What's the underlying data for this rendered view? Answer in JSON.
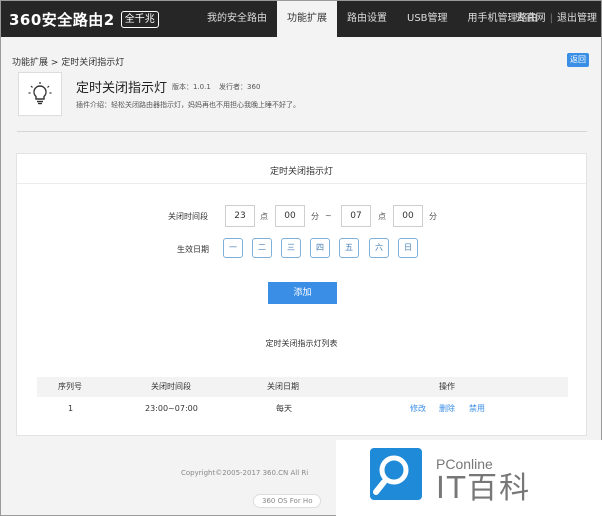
{
  "brand": {
    "name": "360安全路由2",
    "badge": "全千兆"
  },
  "nav": {
    "items": [
      "我的安全路由",
      "功能扩展",
      "路由设置",
      "USB管理",
      "用手机管理路由"
    ],
    "active_index": 1,
    "right": [
      "去官网",
      "退出管理"
    ]
  },
  "breadcrumb": "功能扩展 > 定时关闭指示灯",
  "back_label": "返回",
  "plugin": {
    "icon": "lightbulb-icon",
    "title": "定时关闭指示灯",
    "version": "版本：1.0.1",
    "publisher": "发行者：360",
    "description": "插件介绍：轻松关闭路由器指示灯，妈妈再也不用担心我晚上睡不好了。"
  },
  "form": {
    "title": "定时关闭指示灯",
    "time_label": "关闭时间段",
    "start_hour": "23",
    "start_min": "00",
    "end_hour": "07",
    "end_min": "00",
    "unit_hour": "点",
    "unit_min": "分",
    "range_sep": "~",
    "days_label": "生效日期",
    "days": [
      "一",
      "二",
      "三",
      "四",
      "五",
      "六",
      "日"
    ],
    "add_label": "添加"
  },
  "list": {
    "title": "定时关闭指示灯列表",
    "headers": [
      "序列号",
      "关闭时间段",
      "关闭日期",
      "操作"
    ],
    "rows": [
      {
        "index": "1",
        "time": "23:00~07:00",
        "date": "每天",
        "edit": "修改",
        "delete": "删除",
        "disable": "禁用"
      }
    ]
  },
  "footer": {
    "copyright": "Copyright©2005-2017 360.CN All Ri",
    "os": "360 OS For Ho"
  },
  "watermark": {
    "small": "PConline",
    "big": "IT百科"
  },
  "colors": {
    "accent": "#3a8ee6",
    "nav_bg": "#262626",
    "page_bg": "#f3f3f3"
  }
}
